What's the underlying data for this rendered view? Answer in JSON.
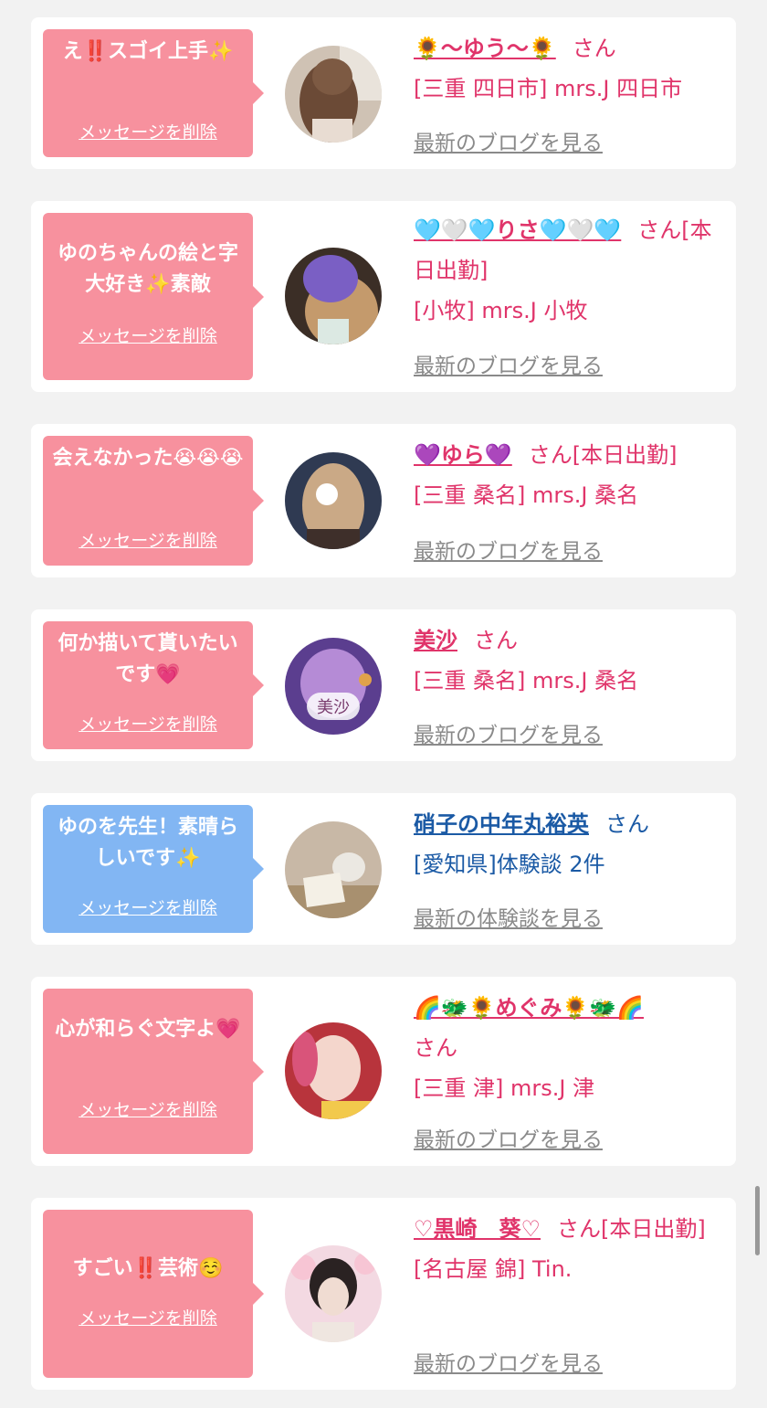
{
  "cards": [
    {
      "message": "え‼️スゴイ上手✨",
      "delete_label": "メッセージを削除",
      "name": "🌻〜ゆう〜🌻",
      "honorific": "さん",
      "status": "",
      "shop": "[三重 四日市] mrs.J 四日市",
      "link": "最新のブログを見る",
      "bubble_color": "#f7919e"
    },
    {
      "message": "ゆのちゃんの絵と字大好き✨素敵",
      "delete_label": "メッセージを削除",
      "name": "🩵🤍🩵りさ🩵🤍🩵",
      "honorific": "さん",
      "status": "[本日出勤]",
      "shop": "[小牧] mrs.J 小牧",
      "link": "最新のブログを見る",
      "bubble_color": "#f7919e"
    },
    {
      "message": "会えなかった😭😭😭",
      "delete_label": "メッセージを削除",
      "name": "💜ゆら💜",
      "honorific": "さん",
      "status": "[本日出勤]",
      "shop": "[三重 桑名] mrs.J 桑名",
      "link": "最新のブログを見る",
      "bubble_color": "#f7919e"
    },
    {
      "message": "何か描いて貰いたいです💗",
      "delete_label": "メッセージを削除",
      "name": "美沙",
      "honorific": "さん",
      "status": "",
      "shop": "[三重 桑名] mrs.J 桑名",
      "link": "最新のブログを見る",
      "bubble_color": "#f7919e",
      "avatar_badge": "美沙"
    },
    {
      "message": "ゆのを先生！素晴らしいです✨",
      "delete_label": "メッセージを削除",
      "name": "硝子の中年丸裕英",
      "honorific": "さん",
      "status": "",
      "shop": "[愛知県]体験談 2件",
      "link": "最新の体験談を見る",
      "bubble_color": "#82b6f3"
    },
    {
      "message": "心が和らぐ文字よ💗",
      "delete_label": "メッセージを削除",
      "name": "🌈🐲🌻めぐみ🌻🐲🌈",
      "honorific": "さん",
      "status": "",
      "shop": "[三重 津] mrs.J 津",
      "link": "最新のブログを見る",
      "bubble_color": "#f7919e"
    },
    {
      "message": "すごい‼️芸術☺️",
      "delete_label": "メッセージを削除",
      "name": "♡黒崎　葵♡",
      "honorific": "さん",
      "status": "[本日出勤]",
      "shop": "[名古屋 錦] Tin.",
      "link": "最新のブログを見る",
      "bubble_color": "#f7919e"
    }
  ]
}
